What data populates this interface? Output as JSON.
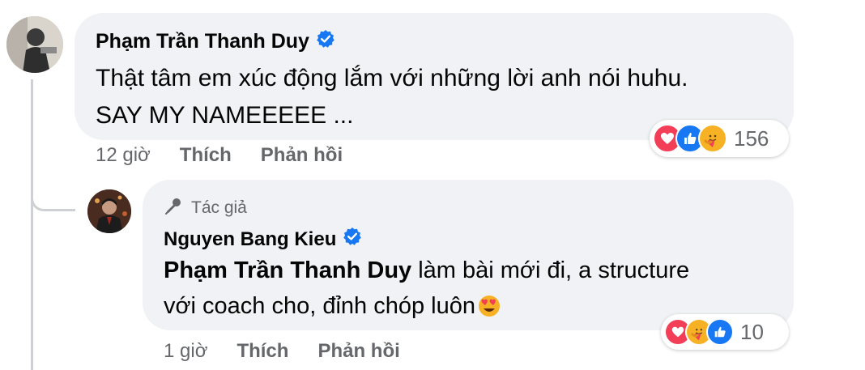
{
  "comments": [
    {
      "author": "Phạm Trần Thanh Duy",
      "verified": true,
      "text_lines": [
        "Thật tâm em xúc động lắm với những lời anh nói huhu.",
        "SAY MY NAMEEEEE ..."
      ],
      "time": "12 giờ",
      "like_label": "Thích",
      "reply_label": "Phản hồi",
      "reactions": {
        "icons": [
          "love-icon",
          "like-icon",
          "care-icon"
        ],
        "count": "156"
      }
    }
  ],
  "reply": {
    "badge_icon": "microphone-icon",
    "badge_label": "Tác giả",
    "author": "Nguyen Bang Kieu",
    "verified": true,
    "mention": "Phạm Trần Thanh Duy",
    "text_line1": " làm bài mới đi, a structure",
    "text_line2": "với coach cho, đỉnh chóp luôn",
    "emoji": "heart-eyes-emoji",
    "time": "1 giờ",
    "like_label": "Thích",
    "reply_label": "Phản hồi",
    "reactions": {
      "icons": [
        "love-icon",
        "care-icon",
        "like-icon"
      ],
      "count": "10"
    }
  },
  "colors": {
    "bubble": "#f0f2f5",
    "verified": "#1877f2",
    "love": "#f33e58",
    "like": "#1877f2",
    "care": "#f7b125",
    "secondary_text": "#65676b"
  }
}
